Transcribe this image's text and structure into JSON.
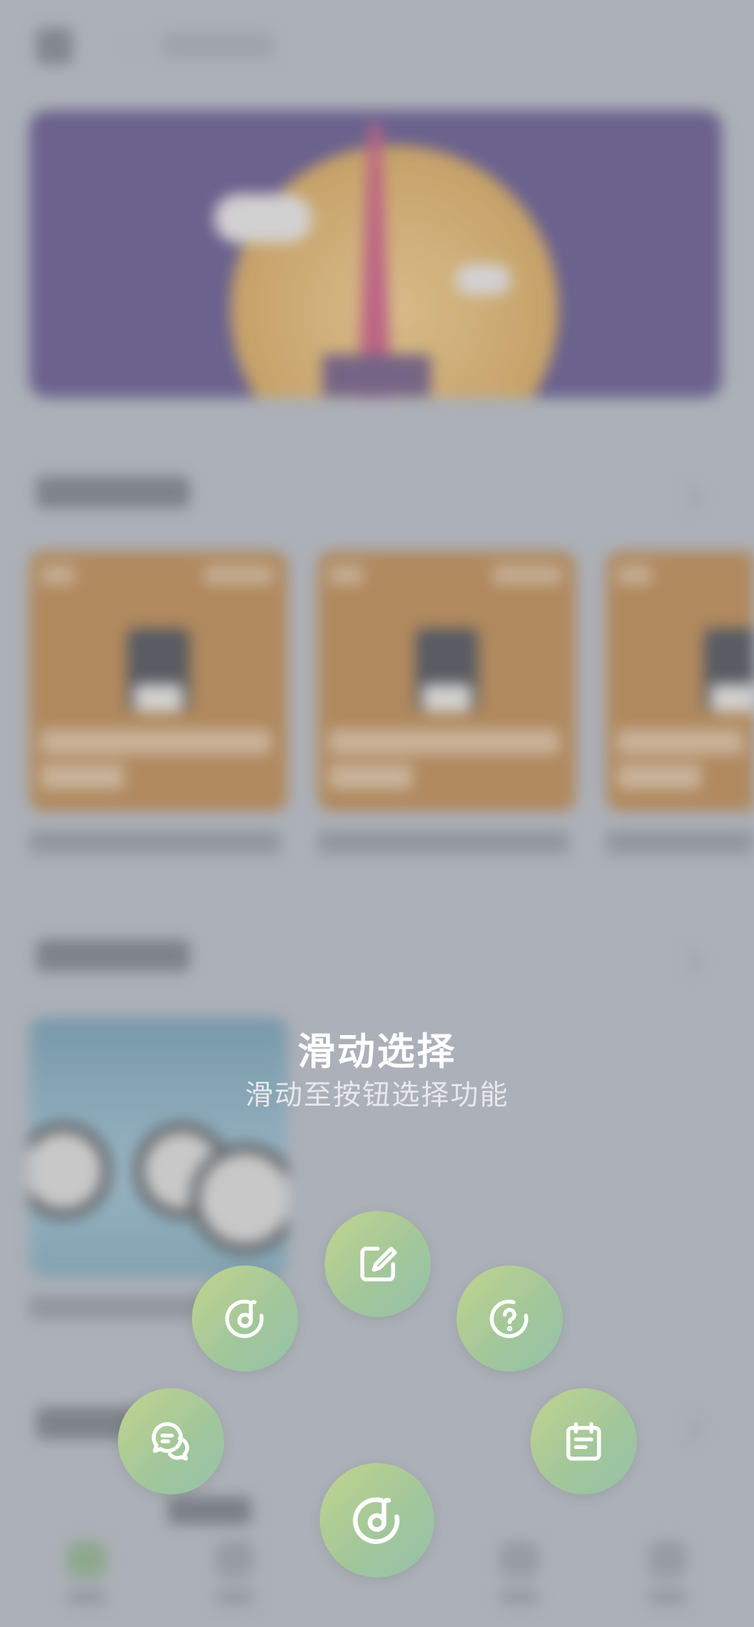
{
  "overlay": {
    "title": "滑动选择",
    "subtitle": "滑动至按钮选择功能"
  },
  "actions": [
    {
      "icon": "edit-icon"
    },
    {
      "icon": "music-disc-icon"
    },
    {
      "icon": "help-icon"
    },
    {
      "icon": "chat-icon"
    },
    {
      "icon": "calendar-icon"
    }
  ],
  "main_button": {
    "icon": "music-disc-icon"
  },
  "colors": {
    "fab_gradient_start": "#c2d48e",
    "fab_gradient_end": "#94c1aa",
    "title": "#ffffff",
    "subtitle": "#e6e8eb"
  }
}
